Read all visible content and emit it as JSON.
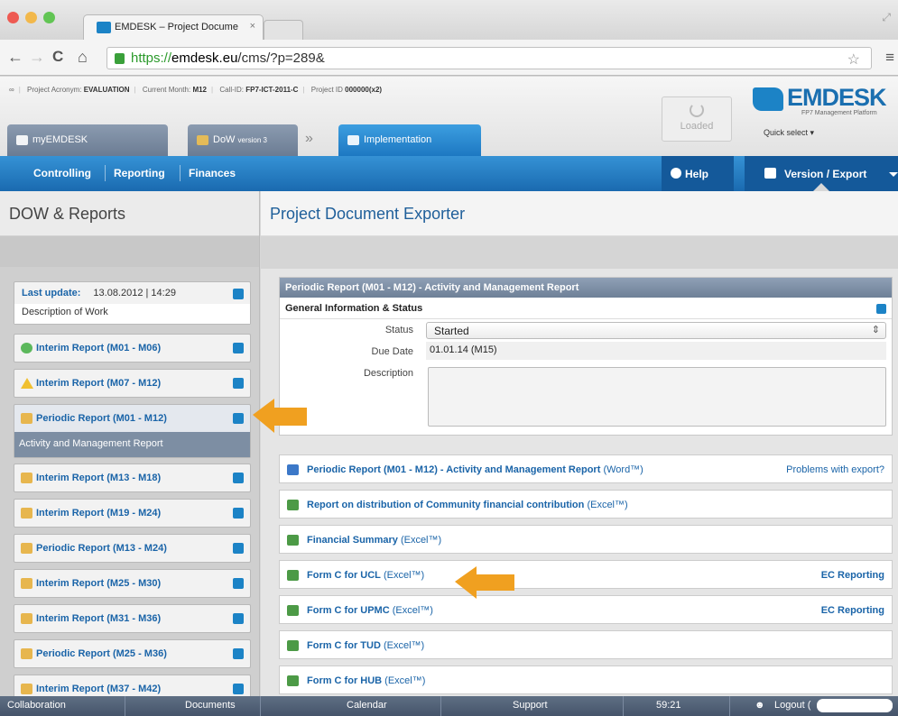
{
  "browser": {
    "tab_title": "EMDESK – Project Docume",
    "tab_close": "×",
    "url_scheme": "https://",
    "url_domain": "emdesk.eu",
    "url_path": "/cms/?p=289&",
    "back": "←",
    "forward": "→",
    "reload": "C",
    "home": "⌂",
    "star": "☆",
    "menu": "≡"
  },
  "project_info": {
    "acronym_label": "Project Acronym:",
    "acronym": "EVALUATION",
    "month_label": "Current Month:",
    "month": "M12",
    "call_label": "Call-ID:",
    "call": "FP7-ICT-2011-C",
    "pid_label": "Project ID",
    "pid": "000000(x2)"
  },
  "header": {
    "tab_my": "myEMDESK",
    "tab_dow": "DoW",
    "tab_dow_version": "version 3",
    "chevron": "»",
    "tab_impl": "Implementation",
    "loaded": "Loaded",
    "logo": "EMDESK",
    "logo_sub": "FP7 Management Platform",
    "quick_select": "Quick select  ▾"
  },
  "nav": {
    "controlling": "Controlling",
    "reporting": "Reporting",
    "finances": "Finances",
    "help": "Help",
    "version_export": "Version / Export"
  },
  "sidebar": {
    "title": "DOW & Reports",
    "last_update_label": "Last update:",
    "last_update_value": "13.08.2012 | 14:29",
    "description_of_work": "Description of Work",
    "items": [
      {
        "title": "Interim Report",
        "range": "(M01 - M06)",
        "state": "ok"
      },
      {
        "title": "Interim Report",
        "range": "(M07 - M12)",
        "state": "warn"
      },
      {
        "title": "Periodic Report",
        "range": "(M01 - M12)",
        "state": "open",
        "sub": "Activity and Management Report"
      },
      {
        "title": "Interim Report",
        "range": "(M13 - M18)",
        "state": "open"
      },
      {
        "title": "Interim Report",
        "range": "(M19 - M24)",
        "state": "open"
      },
      {
        "title": "Periodic Report",
        "range": "(M13 - M24)",
        "state": "open"
      },
      {
        "title": "Interim Report",
        "range": "(M25 - M30)",
        "state": "open"
      },
      {
        "title": "Interim Report",
        "range": "(M31 - M36)",
        "state": "open"
      },
      {
        "title": "Periodic Report",
        "range": "(M25 - M36)",
        "state": "open"
      },
      {
        "title": "Interim Report",
        "range": "(M37 - M42)",
        "state": "open"
      }
    ]
  },
  "main": {
    "title": "Project Document Exporter",
    "panel_title": "Periodic Report (M01 - M12) - Activity and Management Report",
    "general_info": "General Information & Status",
    "status_label": "Status",
    "status_value": "Started",
    "status_arrow": "⇕",
    "due_label": "Due Date",
    "due_value": "01.01.14 (M15)",
    "desc_label": "Description",
    "docs": [
      {
        "title": "Periodic Report (M01 - M12) - Activity and Management Report",
        "format": "(Word™)",
        "right": "Problems with export?",
        "type": "word"
      },
      {
        "title": "Report on distribution of Community financial contribution",
        "format": "(Excel™)",
        "right": "",
        "type": "excel"
      },
      {
        "title": "Financial Summary",
        "format": "(Excel™)",
        "right": "",
        "type": "excel"
      },
      {
        "title": "Form C for UCL",
        "format": "(Excel™)",
        "right": "EC Reporting",
        "type": "excel"
      },
      {
        "title": "Form C for UPMC",
        "format": "(Excel™)",
        "right": "EC Reporting",
        "type": "excel"
      },
      {
        "title": "Form C for TUD",
        "format": "(Excel™)",
        "right": "",
        "type": "excel"
      },
      {
        "title": "Form C for HUB",
        "format": "(Excel™)",
        "right": "",
        "type": "excel"
      }
    ]
  },
  "bottom": {
    "collaboration": "Collaboration",
    "documents": "Documents",
    "calendar": "Calendar",
    "support": "Support",
    "timer": "59:21",
    "logout": "Logout (",
    "logout_end": ")"
  },
  "colors": {
    "accent": "#1c83c6",
    "arrow": "#f0a020",
    "nav_blue": "#1a6ab0"
  }
}
